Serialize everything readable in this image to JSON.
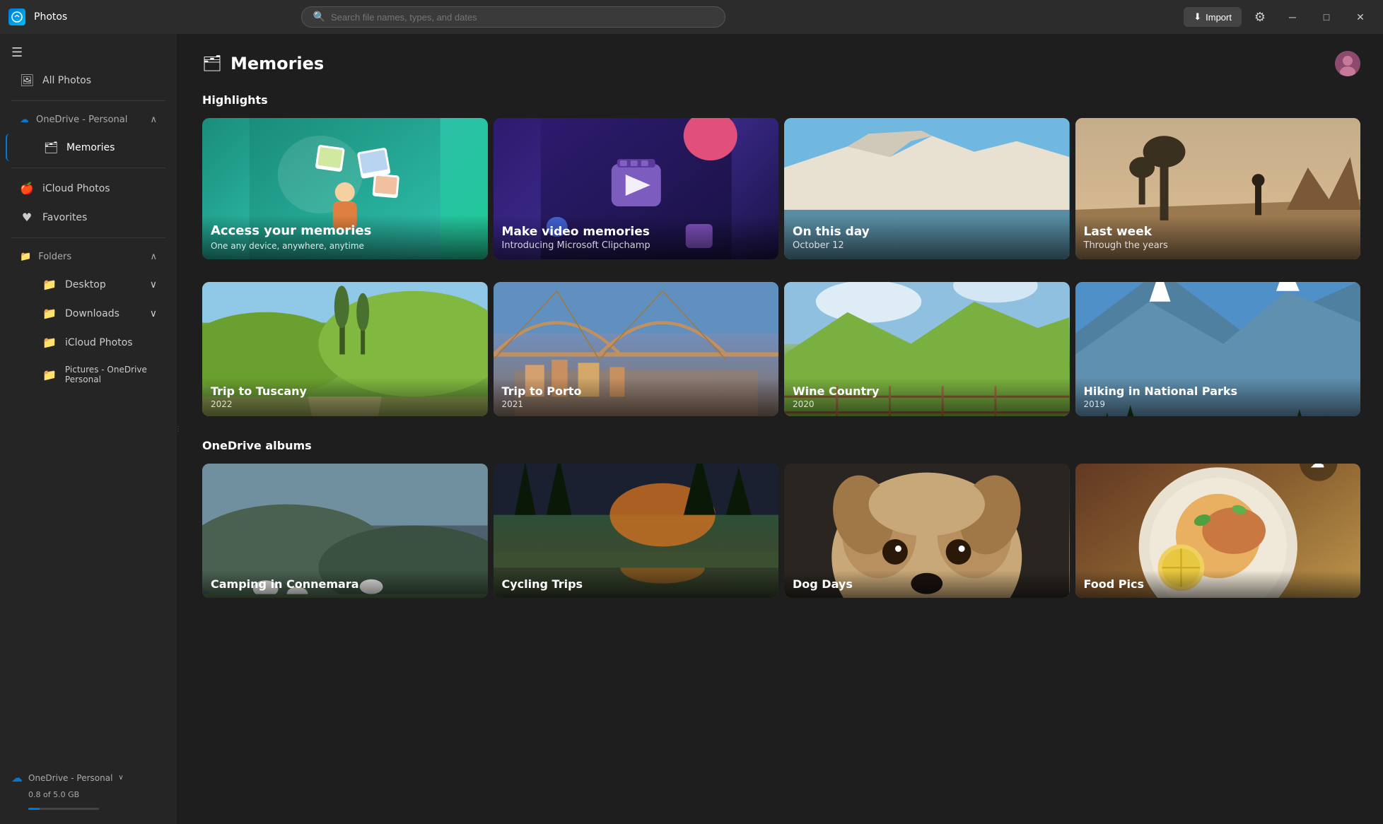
{
  "app": {
    "name": "Photos",
    "title": "Photos"
  },
  "titlebar": {
    "search_placeholder": "Search file names, types, and dates",
    "import_label": "Import",
    "settings_icon": "⚙",
    "minimize_icon": "─",
    "maximize_icon": "□",
    "close_icon": "✕"
  },
  "sidebar": {
    "hamburger_icon": "☰",
    "all_photos_label": "All Photos",
    "onedrive_label": "OneDrive - Personal",
    "memories_label": "Memories",
    "icloud_label": "iCloud Photos",
    "favorites_label": "Favorites",
    "folders_label": "Folders",
    "desktop_label": "Desktop",
    "downloads_label": "Downloads",
    "icloud_photos_label": "iCloud Photos",
    "pictures_label": "Pictures - OneDrive Personal",
    "storage_label": "OneDrive - Personal",
    "storage_info": "0.8 of 5.0 GB"
  },
  "page": {
    "title": "Memories",
    "memories_icon": "🗂"
  },
  "highlights": {
    "section_title": "Highlights",
    "cards": [
      {
        "id": "access-memories",
        "type": "promo",
        "title": "Access your memories",
        "subtitle": "One any device, anywhere, anytime"
      },
      {
        "id": "make-video",
        "type": "video",
        "title": "Make video memories",
        "subtitle": "Introducing Microsoft Clipchamp"
      },
      {
        "id": "on-this-day",
        "type": "photo",
        "title": "On this day",
        "subtitle": "October 12"
      },
      {
        "id": "last-week",
        "type": "photo",
        "title": "Last week",
        "subtitle": "Through the years"
      }
    ]
  },
  "trips": {
    "cards": [
      {
        "id": "tuscany",
        "title": "Trip to Tuscany",
        "year": "2022"
      },
      {
        "id": "porto",
        "title": "Trip to Porto",
        "year": "2021"
      },
      {
        "id": "wine-country",
        "title": "Wine Country",
        "year": "2020"
      },
      {
        "id": "hiking",
        "title": "Hiking in National Parks",
        "year": "2019"
      }
    ]
  },
  "onedrive_albums": {
    "section_title": "OneDrive albums",
    "albums": [
      {
        "id": "connemara",
        "title": "Camping in Connemara",
        "subtitle": ""
      },
      {
        "id": "cycling",
        "title": "Cycling Trips",
        "subtitle": ""
      },
      {
        "id": "dog",
        "title": "Dog Days",
        "subtitle": ""
      },
      {
        "id": "food",
        "title": "Food Pics",
        "subtitle": ""
      }
    ]
  }
}
